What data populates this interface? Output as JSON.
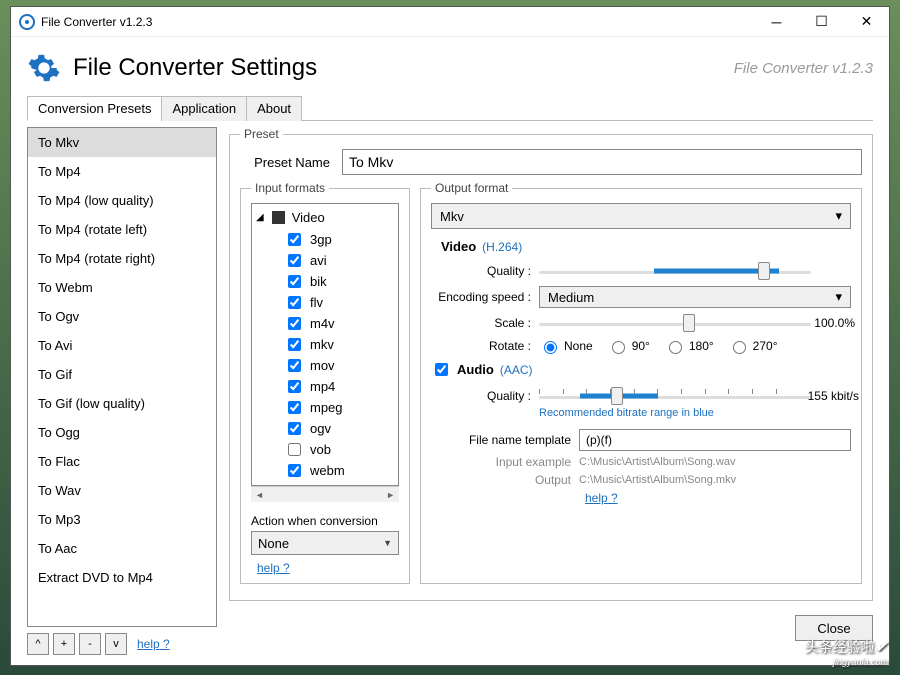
{
  "window": {
    "title": "File Converter v1.2.3",
    "subtitle": "File Converter v1.2.3",
    "page_title": "File Converter Settings",
    "close_btn": "Close"
  },
  "tabs": [
    "Conversion Presets",
    "Application",
    "About"
  ],
  "presets": [
    "To Mkv",
    "To Mp4",
    "To Mp4 (low quality)",
    "To Mp4 (rotate left)",
    "To Mp4 (rotate right)",
    "To Webm",
    "To Ogv",
    "To Avi",
    "To Gif",
    "To Gif (low quality)",
    "To Ogg",
    "To Flac",
    "To Wav",
    "To Mp3",
    "To Aac",
    "Extract DVD to Mp4"
  ],
  "sidebar_buttons": {
    "up": "^",
    "add": "+",
    "remove": "-",
    "down": "v",
    "help": "help ?"
  },
  "preset": {
    "legend": "Preset",
    "name_label": "Preset Name",
    "name_value": "To Mkv"
  },
  "input_formats": {
    "legend": "Input formats",
    "root": "Video",
    "items": [
      {
        "name": "3gp",
        "checked": true
      },
      {
        "name": "avi",
        "checked": true
      },
      {
        "name": "bik",
        "checked": true
      },
      {
        "name": "flv",
        "checked": true
      },
      {
        "name": "m4v",
        "checked": true
      },
      {
        "name": "mkv",
        "checked": true
      },
      {
        "name": "mov",
        "checked": true
      },
      {
        "name": "mp4",
        "checked": true
      },
      {
        "name": "mpeg",
        "checked": true
      },
      {
        "name": "ogv",
        "checked": true
      },
      {
        "name": "vob",
        "checked": false
      },
      {
        "name": "webm",
        "checked": true
      }
    ],
    "action_label": "Action when conversion",
    "action_value": "None",
    "help": "help ?"
  },
  "output": {
    "legend": "Output format",
    "value": "Mkv",
    "video": {
      "title": "Video",
      "codec": "(H.264)",
      "quality_label": "Quality :",
      "enc_label": "Encoding speed :",
      "enc_value": "Medium",
      "scale_label": "Scale :",
      "scale_value": "100.0%",
      "rotate_label": "Rotate :",
      "rotate_options": [
        "None",
        "90°",
        "180°",
        "270°"
      ],
      "rotate_selected": "None"
    },
    "audio": {
      "enabled": true,
      "title": "Audio",
      "codec": "(AAC)",
      "quality_label": "Quality :",
      "quality_value": "155 kbit/s",
      "reco": "Recommended bitrate range in blue"
    },
    "file": {
      "label": "File name template",
      "value": "(p)(f)",
      "in_label": "Input example",
      "in_val": "C:\\Music\\Artist\\Album\\Song.wav",
      "out_label": "Output",
      "out_val": "C:\\Music\\Artist\\Album\\Song.mkv",
      "help": "help ?"
    }
  },
  "watermark": {
    "cn": "头条经验啦",
    "jy": "jingyanla.com"
  }
}
